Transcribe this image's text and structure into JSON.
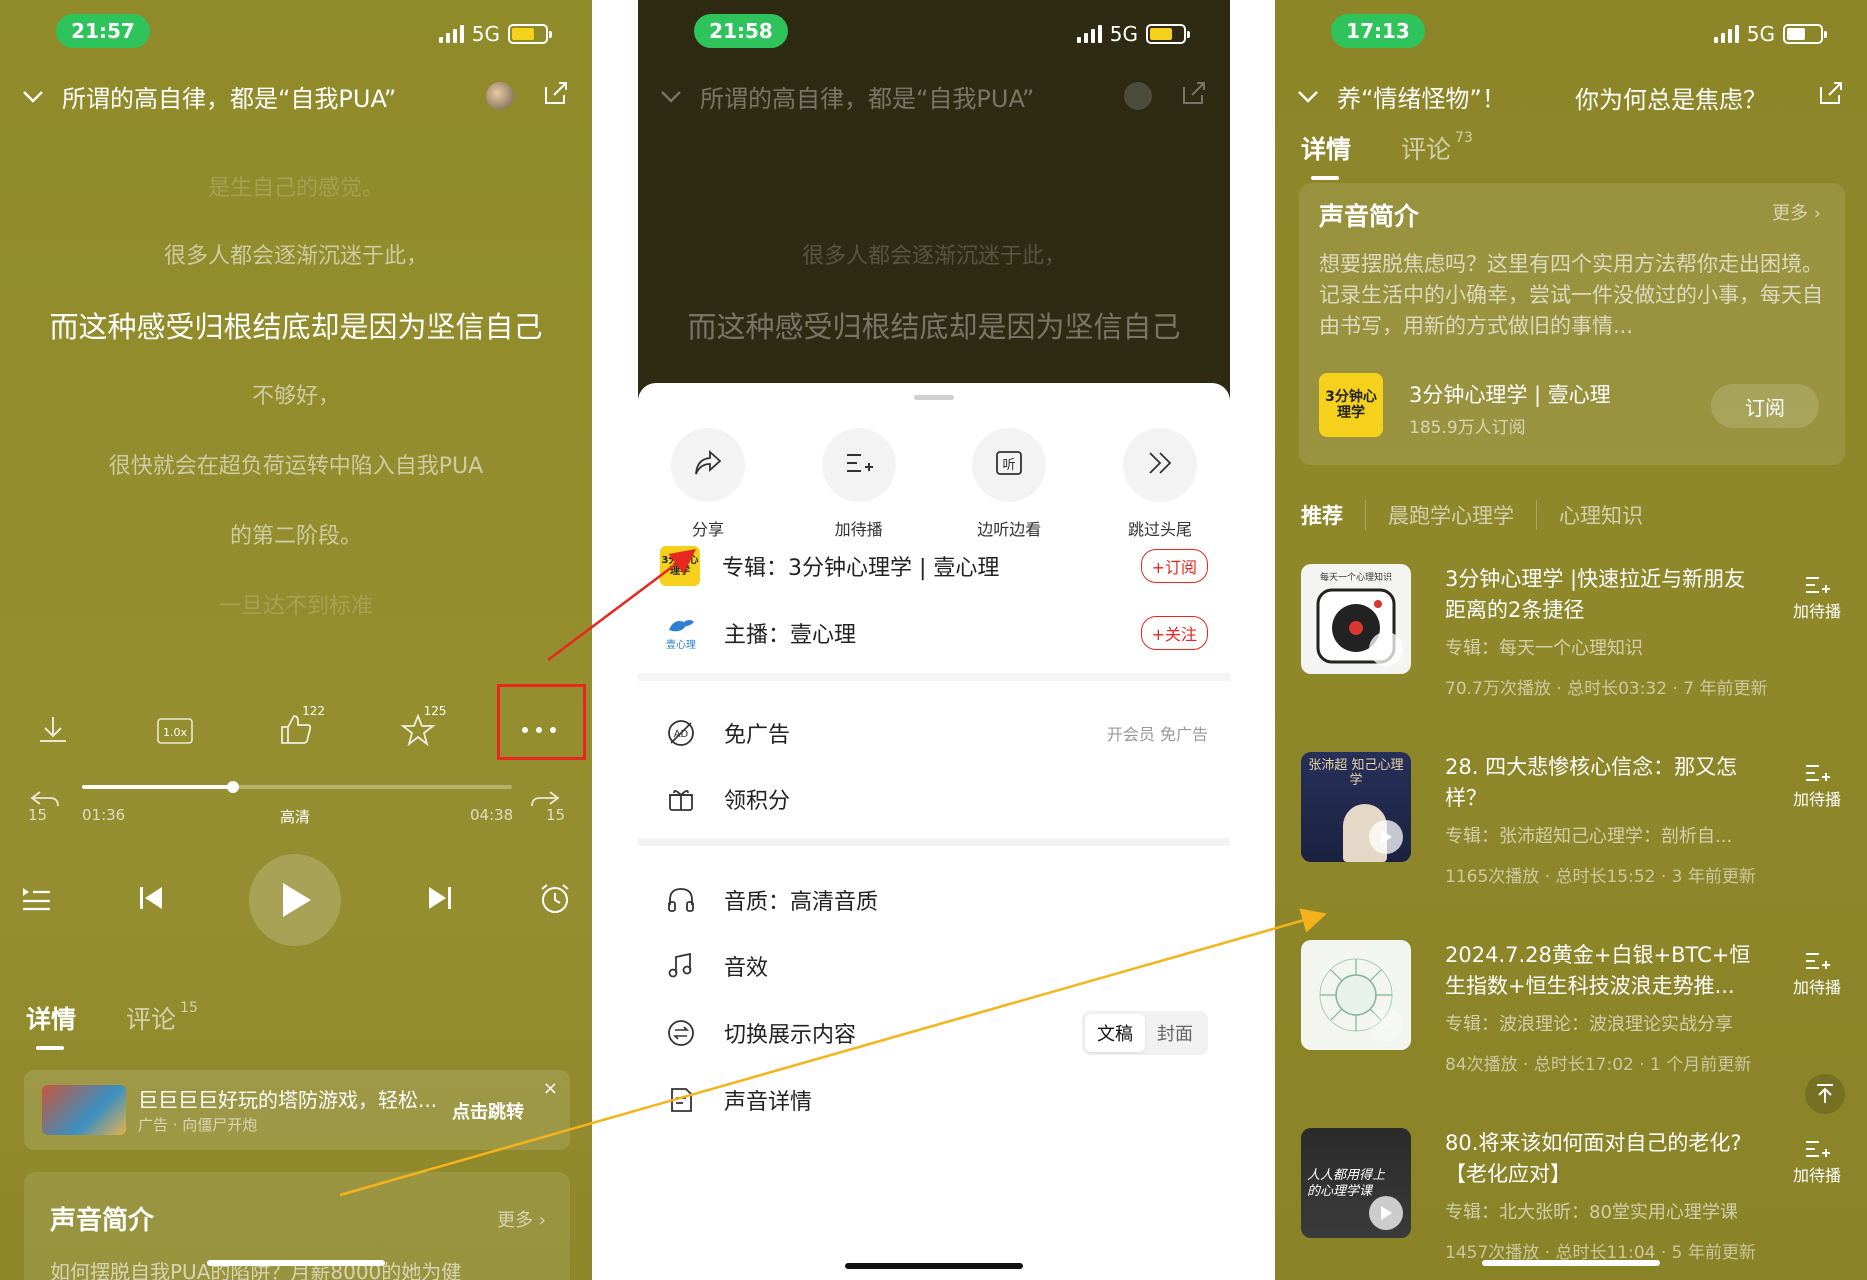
{
  "colors": {
    "accent_green": "#2fc45b",
    "highlight_red": "#e8271f",
    "arrow_red": "#e8271f",
    "arrow_orange": "#f5b31b"
  },
  "panel1": {
    "time": "21:57",
    "network": "5G",
    "title": "所谓的高自律，都是“自我PUA”",
    "lyrics": {
      "l0": "是生自己的感觉。",
      "l1": "很多人都会逐渐沉迷于此，",
      "l2": "而这种感受归根结底却是因为坚信自己",
      "l3": "不够好，",
      "l4": "很快就会在超负荷运转中陷入自我PUA",
      "l5": "的第二阶段。",
      "l6": "一旦达不到标准"
    },
    "controls": {
      "speed_label": "1.0x",
      "like_count": "122",
      "fav_count": "125"
    },
    "progress": {
      "current": "01:36",
      "quality": "高清",
      "total": "04:38",
      "skip_back": "15",
      "skip_fwd": "15",
      "fraction": 0.35
    },
    "tabs": {
      "detail": "详情",
      "comments": "评论",
      "comments_count": "15"
    },
    "ad": {
      "title": "巨巨巨巨好玩的塔防游戏，轻松...",
      "sub": "广告 · 向僵尸开炮",
      "jump": "点击跳转",
      "close": "×"
    },
    "intro": {
      "title": "声音简介",
      "more": "更多 ›",
      "desc": "如何摆脱自我PUA的陷阱？月薪8000的她为健"
    }
  },
  "panel2": {
    "time": "21:58",
    "network": "5G",
    "title": "所谓的高自律，都是“自我PUA”",
    "lyric1": "很多人都会逐渐沉迷于此，",
    "lyric2": "而这种感受归根结底却是因为坚信自己",
    "actions": {
      "share": "分享",
      "queue": "加待播",
      "listen": "边听边看",
      "skip": "跳过头尾"
    },
    "album": {
      "label": "专辑：3分钟心理学 | 壹心理",
      "btn": "+订阅",
      "cover": "3分钟心理学"
    },
    "host": {
      "label": "主播：壹心理",
      "btn": "+关注",
      "logo": "壹心理"
    },
    "noad": {
      "label": "免广告",
      "right": "开会员 免广告"
    },
    "points": {
      "label": "领积分"
    },
    "quality": {
      "label": "音质：高清音质"
    },
    "effects": {
      "label": "音效"
    },
    "display": {
      "label": "切换展示内容",
      "opt1": "文稿",
      "opt2": "封面"
    },
    "details": {
      "label": "声音详情"
    }
  },
  "panel3": {
    "time": "17:13",
    "network": "5G",
    "title": "养“情绪怪物”！",
    "title_right": "你为何总是焦虑？",
    "tabs": {
      "detail": "详情",
      "comments": "评论",
      "comments_count": "73"
    },
    "intro": {
      "title": "声音简介",
      "more": "更多 ›",
      "desc": "想要摆脱焦虑吗？这里有四个实用方法帮你走出困境。记录生活中的小确幸，尝试一件没做过的小事，每天自由书写，用新的方式做旧的事情..."
    },
    "album": {
      "cover": "3分钟心理学",
      "name": "3分钟心理学 | 壹心理",
      "subs": "185.9万人订阅",
      "btn": "订阅"
    },
    "rec_tabs": {
      "t1": "推荐",
      "t2": "晨跑学心理学",
      "t3": "心理知识"
    },
    "queue_label": "加待播",
    "recs": [
      {
        "title": "3分钟心理学 |快速拉近与新朋友距离的2条捷径",
        "album": "专辑：每天一个心理知识",
        "meta": "70.7万次播放 · 总时长03:32 · 7 年前更新",
        "thumb_text": "每天一个心理知识"
      },
      {
        "title": "28. 四大悲惨核心信念：那又怎样？",
        "album": "专辑：张沛超知己心理学：剖析自...",
        "meta": "1165次播放 · 总时长15:52 · 3 年前更新",
        "thumb_text": "张沛超 知己心理学"
      },
      {
        "title": "2024.7.28黄金+白银+BTC+恒生指数+恒生科技波浪走势推...",
        "album": "专辑：波浪理论：波浪理论实战分享",
        "meta": "84次播放 · 总时长17:02 · 1 个月前更新",
        "thumb_text": ""
      },
      {
        "title": "80.将来该如何面对自己的老化?【老化应对】",
        "album": "专辑：北大张昕：80堂实用心理学课",
        "meta": "1457次播放 · 总时长11:04 · 5 年前更新",
        "thumb_text": "人人都用得上的心理学课"
      }
    ]
  }
}
